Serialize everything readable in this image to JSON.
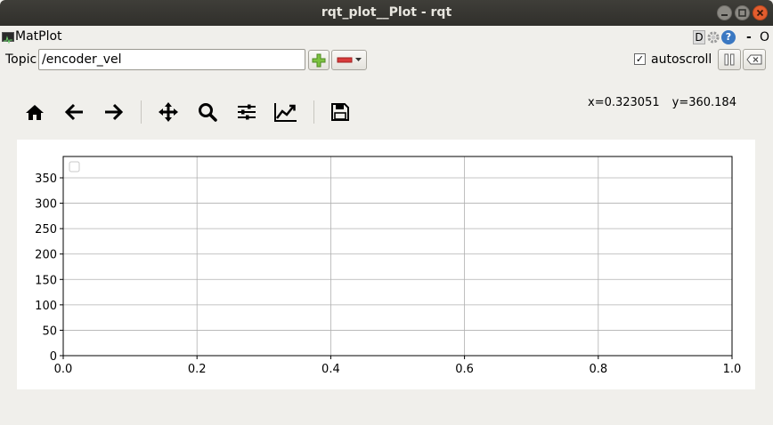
{
  "window": {
    "title": "rqt_plot__Plot - rqt"
  },
  "menubar": {
    "plugin_title": "MatPlot",
    "help_d": "D",
    "help_q": "?",
    "dash": "-",
    "o": "O"
  },
  "topic": {
    "label": "Topic",
    "value": "/encoder_vel",
    "autoscroll_label": "autoscroll",
    "autoscroll_checked": true
  },
  "toolbar": {
    "buttons": [
      "home-icon",
      "back-arrow-icon",
      "forward-arrow-icon",
      "pan-icon",
      "zoom-icon",
      "subplots-config-icon",
      "edit-curves-icon",
      "save-icon"
    ]
  },
  "coordinates": {
    "x": "x=0.323051",
    "y": "y=360.184"
  },
  "chart_data": {
    "type": "line",
    "title": "",
    "xlabel": "",
    "ylabel": "",
    "xlim": [
      0.0,
      1.0
    ],
    "ylim": [
      0,
      392
    ],
    "x_ticks": [
      "0.0",
      "0.2",
      "0.4",
      "0.6",
      "0.8",
      "1.0"
    ],
    "y_ticks": [
      "0",
      "50",
      "100",
      "150",
      "200",
      "250",
      "300",
      "350"
    ],
    "x_tick_values": [
      0.0,
      0.2,
      0.4,
      0.6,
      0.8,
      1.0
    ],
    "y_tick_values": [
      0,
      50,
      100,
      150,
      200,
      250,
      300,
      350
    ],
    "grid": true,
    "legend": "top-left",
    "series": []
  }
}
